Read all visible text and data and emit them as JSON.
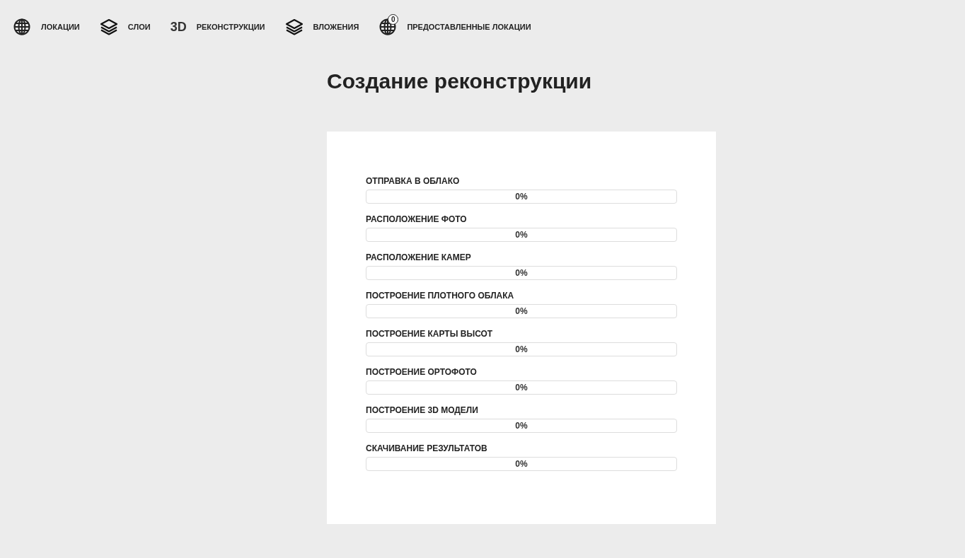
{
  "nav": [
    {
      "kind": "globe",
      "label": "ЛОКАЦИИ"
    },
    {
      "kind": "layers",
      "label": "СЛОИ"
    },
    {
      "kind": "text3d",
      "icon_text": "3D",
      "label": "РЕКОНСТРУКЦИИ"
    },
    {
      "kind": "layers",
      "label": "ВЛОЖЕНИЯ"
    },
    {
      "kind": "globe_badge",
      "badge": "0",
      "label": "ПРЕДОСТАВЛЕННЫЕ ЛОКАЦИИ"
    }
  ],
  "title": "Создание реконструкции",
  "stages": [
    {
      "name": "ОТПРАВКА В ОБЛАКО",
      "level": 0,
      "reading": "0%"
    },
    {
      "name": "РАСПОЛОЖЕНИЕ ФОТО",
      "level": 0,
      "reading": "0%"
    },
    {
      "name": "РАСПОЛОЖЕНИЕ КАМЕР",
      "level": 0,
      "reading": "0%"
    },
    {
      "name": "ПОСТРОЕНИЕ ПЛОТНОГО ОБЛАКА",
      "level": 0,
      "reading": "0%"
    },
    {
      "name": "ПОСТРОЕНИЕ КАРТЫ ВЫСОТ",
      "level": 0,
      "reading": "0%"
    },
    {
      "name": "ПОСТРОЕНИЕ ОРТОФОТО",
      "level": 0,
      "reading": "0%"
    },
    {
      "name": "ПОСТРОЕНИЕ 3D МОДЕЛИ",
      "level": 0,
      "reading": "0%"
    },
    {
      "name": "СКАЧИВАНИЕ РЕЗУЛЬТАТОВ",
      "level": 0,
      "reading": "0%"
    }
  ]
}
